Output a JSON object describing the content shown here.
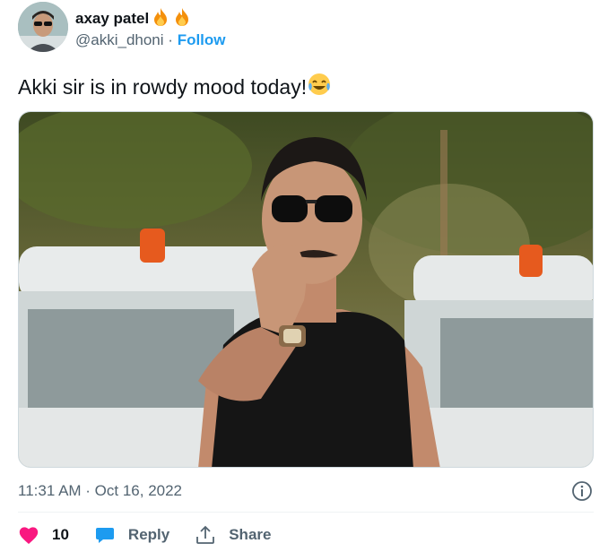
{
  "author": {
    "display_name": "axay patel",
    "handle": "@akki_dhoni",
    "separator": "·",
    "follow_label": "Follow"
  },
  "tweet": {
    "text": "Akki sir is in rowdy mood today!",
    "timestamp": "11:31 AM · Oct 16, 2022"
  },
  "actions": {
    "like_count": "10",
    "reply_label": "Reply",
    "share_label": "Share"
  },
  "colors": {
    "accent": "#1d9bf0",
    "like": "#f91880",
    "muted": "#536471"
  }
}
